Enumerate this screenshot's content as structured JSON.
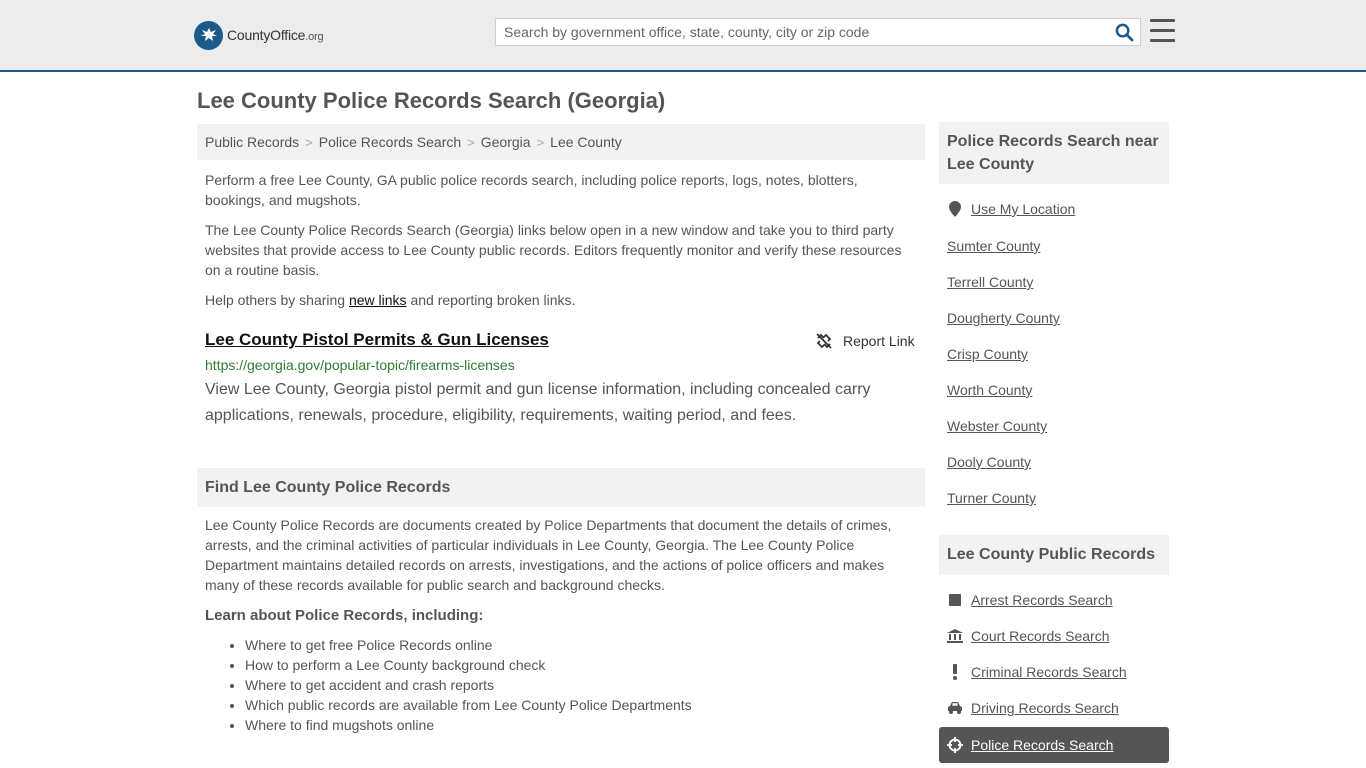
{
  "header": {
    "logo_brand": "CountyOffice",
    "logo_tld": ".org",
    "search_placeholder": "Search by government office, state, county, city or zip code"
  },
  "page": {
    "title": "Lee County Police Records Search (Georgia)"
  },
  "breadcrumb": [
    "Public Records",
    "Police Records Search",
    "Georgia",
    "Lee County"
  ],
  "intro": {
    "p1": "Perform a free Lee County, GA public police records search, including police reports, logs, notes, blotters, bookings, and mugshots.",
    "p2": "The Lee County Police Records Search (Georgia) links below open in a new window and take you to third party websites that provide access to Lee County public records. Editors frequently monitor and verify these resources on a routine basis.",
    "p3_before": "Help others by sharing ",
    "p3_link": "new links",
    "p3_after": " and reporting broken links."
  },
  "result": {
    "title": "Lee County Pistol Permits & Gun Licenses",
    "report_label": "Report Link",
    "url": "https://georgia.gov/popular-topic/firearms-licenses",
    "description": "View Lee County, Georgia pistol permit and gun license information, including concealed carry applications, renewals, procedure, eligibility, requirements, waiting period, and fees."
  },
  "find_section": {
    "heading": "Find Lee County Police Records",
    "body": "Lee County Police Records are documents created by Police Departments that document the details of crimes, arrests, and the criminal activities of particular individuals in Lee County, Georgia. The Lee County Police Department maintains detailed records on arrests, investigations, and the actions of police officers and makes many of these records available for public search and background checks.",
    "learn_heading": "Learn about Police Records, including:",
    "learn_items": [
      "Where to get free Police Records online",
      "How to perform a Lee County background check",
      "Where to get accident and crash reports",
      "Which public records are available from Lee County Police Departments",
      "Where to find mugshots online"
    ]
  },
  "sidebar": {
    "near_heading": "Police Records Search near Lee County",
    "use_location": "Use My Location",
    "near_counties": [
      "Sumter County",
      "Terrell County",
      "Dougherty County",
      "Crisp County",
      "Worth County",
      "Webster County",
      "Dooly County",
      "Turner County"
    ],
    "public_heading": "Lee County Public Records",
    "public_links": [
      {
        "label": "Arrest Records Search",
        "icon": "square-icon"
      },
      {
        "label": "Court Records Search",
        "icon": "courthouse-icon"
      },
      {
        "label": "Criminal Records Search",
        "icon": "exclamation-icon"
      },
      {
        "label": "Driving Records Search",
        "icon": "car-icon"
      }
    ],
    "active_link": {
      "label": "Police Records Search",
      "icon": "crosshair-icon"
    }
  },
  "colors": {
    "header_bg": "#ececec",
    "accent_blue": "#1d5a8a",
    "url_green": "#2e7d32",
    "active_bg": "#555555"
  }
}
